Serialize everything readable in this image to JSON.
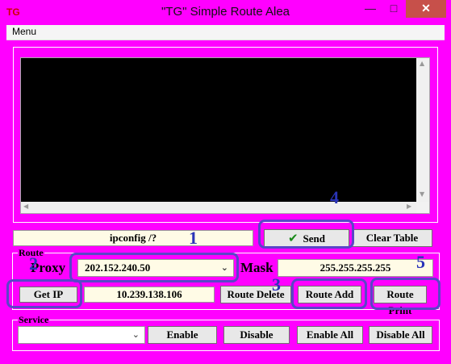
{
  "window": {
    "title": "\"TG\"  Simple Route  Alea",
    "app_icon": "TG",
    "minimize_glyph": "—",
    "maximize_glyph": "□",
    "close_glyph": "✕"
  },
  "menu": {
    "label": "Menu"
  },
  "command": {
    "value": "ipconfig /?",
    "send_label": "Send",
    "clear_label": "Clear Table"
  },
  "route": {
    "group_label": "Route",
    "proxy_label": "Proxy",
    "proxy_value": "202.152.240.50",
    "mask_label": "Mask",
    "mask_value": "255.255.255.255",
    "get_ip_label": "Get IP",
    "ip_value": "10.239.138.106",
    "delete_label": "Route Delete",
    "add_label": "Route Add",
    "print_label": "Route Print"
  },
  "service": {
    "group_label": "Service",
    "selected": "",
    "enable_label": "Enable",
    "disable_label": "Disable",
    "enable_all_label": "Enable All",
    "disable_all_label": "Disable All"
  },
  "annotations": [
    "1",
    "2",
    "3",
    "4",
    "5"
  ],
  "colors": {
    "background": "#ff00ff",
    "annotation": "#5a45c8",
    "send_check": "#1a8a1a"
  }
}
